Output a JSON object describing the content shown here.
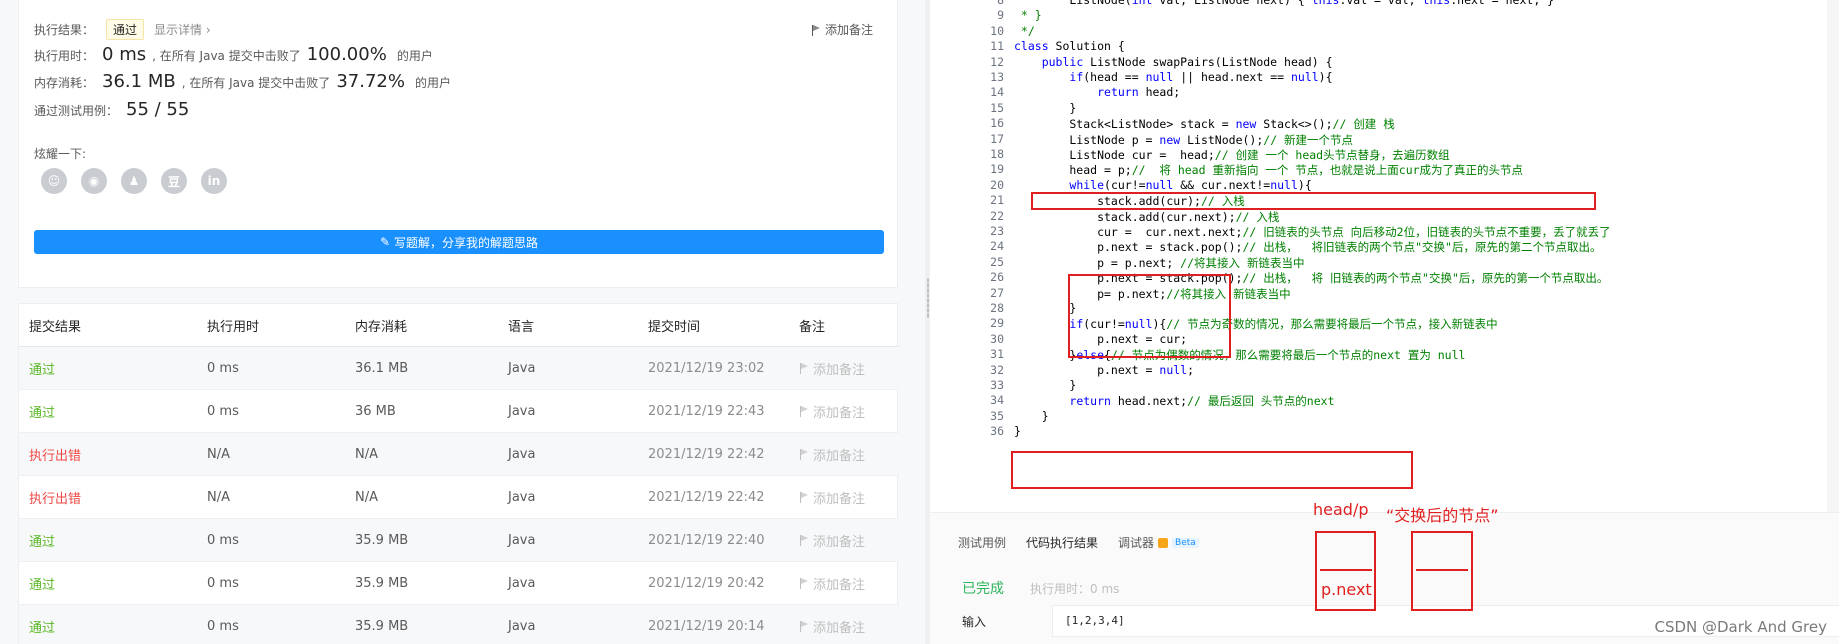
{
  "result": {
    "status_label": "执行结果：",
    "status_tag": "通过",
    "detail_link": "显示详情 ›",
    "add_note": "添加备注",
    "runtime_label": "执行用时：",
    "runtime_value": "0 ms",
    "runtime_beat_prefix": ", 在所有 Java 提交中击败了",
    "runtime_pct": "100.00%",
    "runtime_suffix": "的用户",
    "memory_label": "内存消耗：",
    "memory_value": "36.1 MB",
    "memory_beat_prefix": ", 在所有 Java 提交中击败了",
    "memory_pct": "37.72%",
    "memory_suffix": "的用户",
    "testcase_label": "通过测试用例：",
    "testcase_value": "55 / 55",
    "share_label": "炫耀一下:",
    "share_icons": [
      "wechat-icon",
      "weibo-icon",
      "qq-icon",
      "douban-icon",
      "linkedin-icon"
    ],
    "share_glyphs": [
      "☺",
      "◉",
      "♟",
      "豆",
      "in"
    ],
    "write_button": "写题解，分享我的解题思路"
  },
  "submissions": {
    "headers": [
      "提交结果",
      "执行用时",
      "内存消耗",
      "语言",
      "提交时间",
      "备注"
    ],
    "rows": [
      {
        "result": "通过",
        "time": "0 ms",
        "memory": "36.1 MB",
        "lang": "Java",
        "submitted": "2021/12/19 23:02",
        "note": "添加备注",
        "ok": true
      },
      {
        "result": "通过",
        "time": "0 ms",
        "memory": "36 MB",
        "lang": "Java",
        "submitted": "2021/12/19 22:43",
        "note": "添加备注",
        "ok": true
      },
      {
        "result": "执行出错",
        "time": "N/A",
        "memory": "N/A",
        "lang": "Java",
        "submitted": "2021/12/19 22:42",
        "note": "添加备注",
        "ok": false
      },
      {
        "result": "执行出错",
        "time": "N/A",
        "memory": "N/A",
        "lang": "Java",
        "submitted": "2021/12/19 22:42",
        "note": "添加备注",
        "ok": false
      },
      {
        "result": "通过",
        "time": "0 ms",
        "memory": "35.9 MB",
        "lang": "Java",
        "submitted": "2021/12/19 22:40",
        "note": "添加备注",
        "ok": true
      },
      {
        "result": "通过",
        "time": "0 ms",
        "memory": "35.9 MB",
        "lang": "Java",
        "submitted": "2021/12/19 20:42",
        "note": "添加备注",
        "ok": true
      },
      {
        "result": "通过",
        "time": "0 ms",
        "memory": "35.9 MB",
        "lang": "Java",
        "submitted": "2021/12/19 20:14",
        "note": "添加备注",
        "ok": true
      }
    ]
  },
  "editor": {
    "lines": [
      {
        "n": "8",
        "text": "        ListNode(int val, ListNode next) { this.val = val; this.next = next; }"
      },
      {
        "n": "9",
        "text": " * }"
      },
      {
        "n": "10",
        "text": " */"
      },
      {
        "n": "11",
        "text": "class Solution {"
      },
      {
        "n": "12",
        "text": "    public ListNode swapPairs(ListNode head) {"
      },
      {
        "n": "13",
        "text": "        if(head == null || head.next == null){"
      },
      {
        "n": "14",
        "text": "            return head;"
      },
      {
        "n": "15",
        "text": "        }"
      },
      {
        "n": "16",
        "text": "        Stack<ListNode> stack = new Stack<>();// 创建 栈"
      },
      {
        "n": "17",
        "text": "        ListNode p = new ListNode();// 新建一个节点"
      },
      {
        "n": "18",
        "text": "        ListNode cur =  head;// 创建 一个 head头节点替身，去遍历数组"
      },
      {
        "n": "19",
        "text": "        head = p;//  将 head 重新指向 一个 节点，也就是说上面cur成为了真正的头节点"
      },
      {
        "n": "20",
        "text": "        while(cur!=null && cur.next!=null){"
      },
      {
        "n": "21",
        "text": "            stack.add(cur);// 入栈"
      },
      {
        "n": "22",
        "text": "            stack.add(cur.next);// 入栈"
      },
      {
        "n": "23",
        "text": "            cur =  cur.next.next;// 旧链表的头节点 向后移动2位，旧链表的头节点不重要，丢了就丢了"
      },
      {
        "n": "24",
        "text": "            p.next = stack.pop();// 出栈，  将旧链表的两个节点\"交换\"后，原先的第二个节点取出。"
      },
      {
        "n": "25",
        "text": "            p = p.next; //将其接入 新链表当中"
      },
      {
        "n": "26",
        "text": "            p.next = stack.pop();// 出栈，  将 旧链表的两个节点\"交换\"后，原先的第一个节点取出。"
      },
      {
        "n": "27",
        "text": "            p= p.next;//将其接入 新链表当中"
      },
      {
        "n": "28",
        "text": "        }"
      },
      {
        "n": "29",
        "text": "        if(cur!=null){// 节点为奇数的情况，那么需要将最后一个节点，接入新链表中"
      },
      {
        "n": "30",
        "text": "            p.next = cur;"
      },
      {
        "n": "31",
        "text": "        }else{// 节点为偶数的情况，那么需要将最后一个节点的next 置为 null"
      },
      {
        "n": "32",
        "text": "            p.next = null;"
      },
      {
        "n": "33",
        "text": "        }"
      },
      {
        "n": "34",
        "text": "        return head.next;// 最后返回 头节点的next"
      },
      {
        "n": "35",
        "text": "    }"
      },
      {
        "n": "36",
        "text": "}"
      }
    ]
  },
  "console": {
    "tabs": [
      "测试用例",
      "代码执行结果",
      "调试器"
    ],
    "beta": "Beta",
    "done": "已完成",
    "exec_time": "执行用时：0 ms",
    "input_label": "输入",
    "input_value": "[1,2,3,4]"
  },
  "annotations": {
    "head_p": "head/p",
    "swapped": "“交换后的节点”",
    "p_next": "p.next"
  },
  "watermark": "CSDN @Dark And Grey",
  "colors": {
    "accent": "#1a90ff",
    "pass": "#5ab726",
    "error": "#ef4743",
    "annotation": "#e02020"
  }
}
